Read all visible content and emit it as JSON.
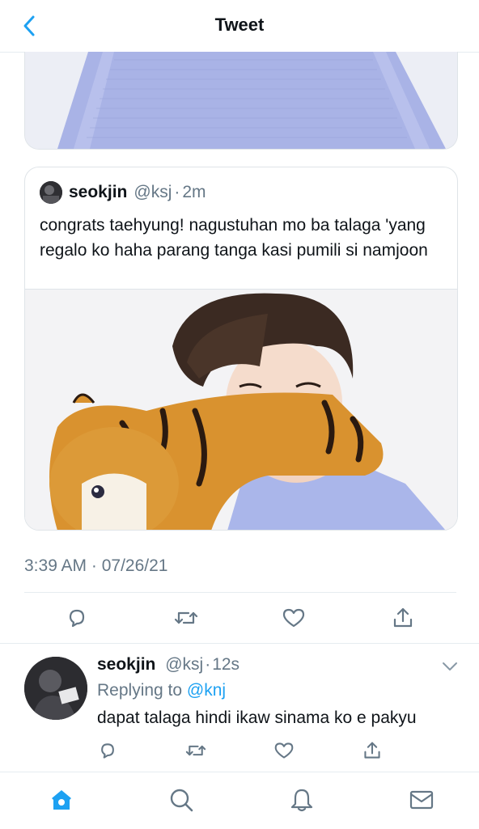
{
  "header": {
    "title": "Tweet"
  },
  "quoted_tweet": {
    "name": "seokjin",
    "handle": "@ksj",
    "separator": "·",
    "time": "2m",
    "text": "congrats taehyung! nagustuhan mo ba talaga 'yang regalo ko haha parang tanga kasi pumili si namjoon"
  },
  "tweet": {
    "timestamp": "3:39 AM · 07/26/21"
  },
  "reply": {
    "name": "seokjin",
    "handle": "@ksj",
    "separator": "·",
    "time": "12s",
    "replying_prefix": "Replying to",
    "replying_to": "@knj",
    "text": "dapat talaga hindi ikaw sinama ko e pakyu"
  },
  "colors": {
    "accent": "#1da1f2",
    "muted": "#657786",
    "divider": "#e6ecf0",
    "text": "#0f1419"
  },
  "icons": {
    "back": "chevron-left-icon",
    "reply": "comment-icon",
    "retweet": "retweet-icon",
    "like": "heart-icon",
    "share": "share-icon",
    "caret": "chevron-down-icon",
    "home": "home-icon",
    "search": "search-icon",
    "notifications": "bell-icon",
    "messages": "mail-icon"
  }
}
